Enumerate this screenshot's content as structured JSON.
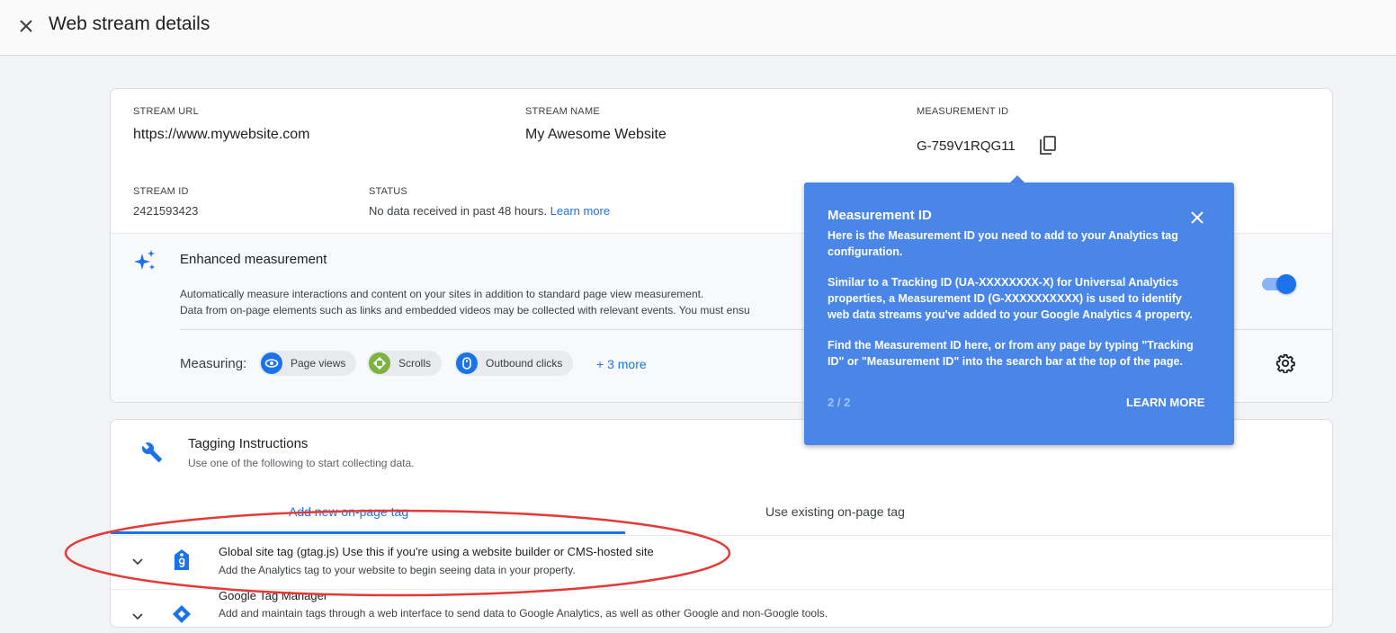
{
  "header": {
    "title": "Web stream details"
  },
  "stream": {
    "url_label": "STREAM URL",
    "url": "https://www.mywebsite.com",
    "name_label": "STREAM NAME",
    "name": "My Awesome Website",
    "measurement_label": "MEASUREMENT ID",
    "measurement_id": "G-759V1RQG11",
    "id_label": "STREAM ID",
    "id": "2421593423",
    "status_label": "STATUS",
    "status_text": "No data received in past 48 hours.",
    "status_link": "Learn more"
  },
  "enhanced": {
    "title": "Enhanced measurement",
    "desc_line1": "Automatically measure interactions and content on your sites in addition to standard page view measurement.",
    "desc_line2": "Data from on-page elements such as links and embedded videos may be collected with relevant events. You must ensu",
    "measuring_label": "Measuring:",
    "chips": [
      {
        "label": "Page views",
        "color": "#1a73e8"
      },
      {
        "label": "Scrolls",
        "color": "#7cb342"
      },
      {
        "label": "Outbound clicks",
        "color": "#1a73e8"
      }
    ],
    "more": "+ 3 more",
    "toggle_on": true
  },
  "tagging": {
    "title": "Tagging Instructions",
    "subtitle": "Use one of the following to start collecting data.",
    "tabs": [
      {
        "label": "Add new on-page tag",
        "active": true
      },
      {
        "label": "Use existing on-page tag",
        "active": false
      }
    ],
    "rows": [
      {
        "title": "Global site tag (gtag.js)",
        "title_rest": "Use this if you're using a website builder or CMS-hosted site",
        "desc": "Add the Analytics tag to your website to begin seeing data in your property."
      },
      {
        "title": "Google Tag Manager",
        "title_rest": "",
        "desc": "Add and maintain tags through a web interface to send data to Google Analytics, as well as other Google and non-Google tools."
      }
    ]
  },
  "popup": {
    "title": "Measurement ID",
    "p1": "Here is the Measurement ID you need to add to your Analytics tag configuration.",
    "p2": "Similar to a Tracking ID (UA-XXXXXXXX-X) for Universal Analytics properties, a Measurement ID (G-XXXXXXXXXX) is used to identify web data streams you've added to your Google Analytics 4 property.",
    "p3": "Find the Measurement ID here, or from any page by typing \"Tracking ID\" or \"Measurement ID\" into the search bar at the top of the page.",
    "page": "2 / 2",
    "learn_more": "LEARN MORE",
    "bg_color": "#4a86e8"
  },
  "annotation": {
    "color": "#e53935"
  }
}
